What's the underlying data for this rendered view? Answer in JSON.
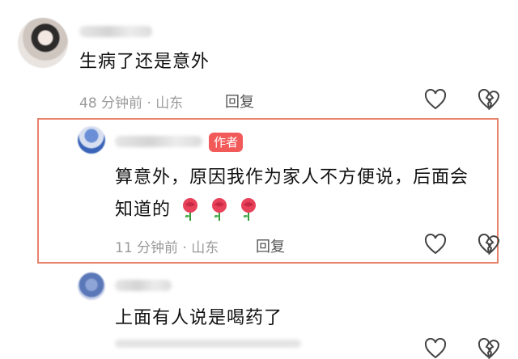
{
  "comments": [
    {
      "text": "生病了还是意外",
      "time": "48 分钟前",
      "sep": " · ",
      "location": "山东",
      "reply_label": "回复"
    },
    {
      "author_badge": "作者",
      "text_line1": "算意外，原因我作为家人不方便说，后面会",
      "text_line2": "知道的",
      "emojis": [
        "rose-icon",
        "rose-icon",
        "rose-icon"
      ],
      "time": "11 分钟前",
      "sep": " · ",
      "location": "山东",
      "reply_label": "回复"
    },
    {
      "text": "上面有人说是喝药了"
    }
  ],
  "colors": {
    "highlight_border": "#e8826a",
    "badge_bg": "#f25a5a"
  }
}
